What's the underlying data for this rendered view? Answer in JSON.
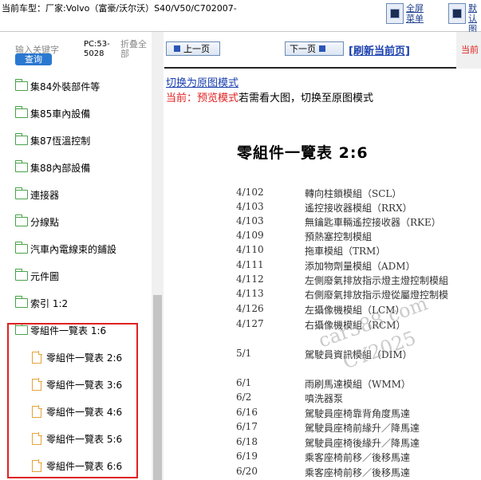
{
  "topbar": {
    "title": "当前车型：厂家:Volvo（富豪/沃尔沃）S40/V50/C702007-",
    "btn1_label": "全屏\n菜单",
    "btn2_label": "默\n认图"
  },
  "left": {
    "search_placeholder": "输入关键字",
    "search_button": "查询",
    "pc_label": "PC:53-5028",
    "fold_all": "折叠全部",
    "tree": [
      {
        "label": "集84外裝部件等",
        "type": "folder"
      },
      {
        "label": "集85車內設備",
        "type": "folder"
      },
      {
        "label": "集87恆溫控制",
        "type": "folder"
      },
      {
        "label": "集88內部設備",
        "type": "folder"
      },
      {
        "label": "連接器",
        "type": "folder"
      },
      {
        "label": "分線點",
        "type": "folder"
      },
      {
        "label": "汽車內電線束的鋪設",
        "type": "folder"
      },
      {
        "label": "元件圖",
        "type": "folder"
      },
      {
        "label": "索引 1:2",
        "type": "folder"
      },
      {
        "label": "零組件一覽表 1:6",
        "type": "folder-open"
      },
      {
        "label": "零組件一覽表 2:6",
        "type": "page"
      },
      {
        "label": "零組件一覽表 3:6",
        "type": "page"
      },
      {
        "label": "零組件一覽表 4:6",
        "type": "page"
      },
      {
        "label": "零組件一覽表 5:6",
        "type": "page"
      },
      {
        "label": "零組件一覽表 6:6",
        "type": "page"
      }
    ]
  },
  "right": {
    "prev_label": "上一页",
    "next_label": "下一页",
    "refresh_label": "[刷新当前页]",
    "current_tag": "当前",
    "switch_link": "切换为原图模式",
    "mode_prefix": "当前：预览模式",
    "mode_suffix": "若需看大图，切换至原图模式",
    "doc_title": "零組件一覽表 2:6",
    "rows": [
      {
        "code": "4/102",
        "desc": "轉向柱鎖模組（SCL）"
      },
      {
        "code": "4/103",
        "desc": "遙控接收器模組（RRX）"
      },
      {
        "code": "4/103",
        "desc": "無鑰匙車輛遙控接收器（RKE）"
      },
      {
        "code": "4/109",
        "desc": "預熱塞控制模組"
      },
      {
        "code": "4/110",
        "desc": "拖車模組（TRM）"
      },
      {
        "code": "4/111",
        "desc": "添加物劑量模組（ADM）"
      },
      {
        "code": "4/112",
        "desc": "左側廢氣排放指示燈主燈控制模組"
      },
      {
        "code": "4/113",
        "desc": "右側廢氣排放指示燈從屬燈控制模"
      },
      {
        "code": "4/126",
        "desc": "左攝像機模組（LCM）"
      },
      {
        "code": "4/127",
        "desc": "右攝像機模組（RCM）"
      },
      {
        "code": "5/1",
        "desc": "駕駛員資訊模組（DIM）"
      },
      {
        "code": "6/1",
        "desc": "雨刷馬達模組（WMM）"
      },
      {
        "code": "6/2",
        "desc": "噴洗器泵"
      },
      {
        "code": "6/16",
        "desc": "駕駛員座椅靠背角度馬達"
      },
      {
        "code": "6/17",
        "desc": "駕駛員座椅前緣升／降馬達"
      },
      {
        "code": "6/18",
        "desc": "駕駛員座椅後緣升／降馬達"
      },
      {
        "code": "6/19",
        "desc": "乘客座椅前移／後移馬達"
      },
      {
        "code": "6/20",
        "desc": "乘客座椅前移／後移馬達"
      }
    ],
    "watermark1": "car388.com",
    "watermark2": "CY2025"
  },
  "colors": {
    "accent_blue": "#2b78d1",
    "link_blue": "#1a3fae",
    "highlight_red": "#e02020",
    "folder_green": "#4aa24a",
    "page_orange": "#e5a33a"
  }
}
